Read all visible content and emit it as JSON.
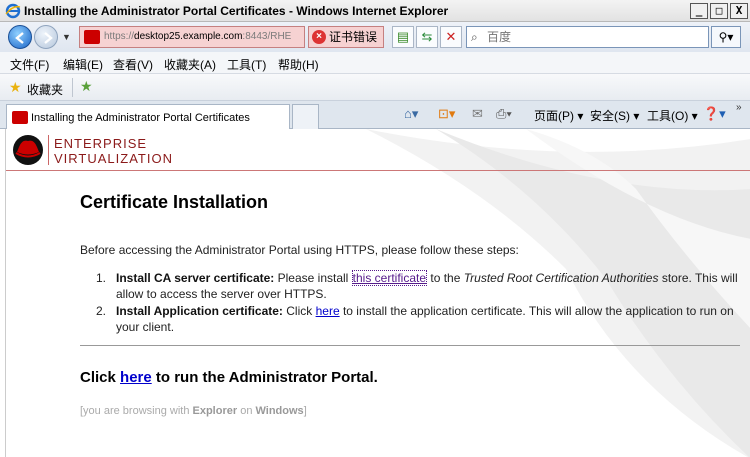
{
  "window": {
    "title": "Installing the Administrator Portal Certificates - Windows Internet Explorer",
    "min_label": "_",
    "max_label": "□",
    "close_label": "X"
  },
  "address": {
    "url_prefix": "https://",
    "url_host": "desktop25.example.com",
    "url_rest": ":8443/RHE",
    "cert_error": "证书错误",
    "search_placeholder": "百度"
  },
  "menu": [
    "文件(F)",
    "编辑(E)",
    "查看(V)",
    "收藏夹(A)",
    "工具(T)",
    "帮助(H)"
  ],
  "favorites": {
    "label": "收藏夹"
  },
  "tab": {
    "title": "Installing the Administrator Portal Certificates"
  },
  "commandbar": {
    "page": "页面(P)",
    "safety": "安全(S)",
    "tools": "工具(O)"
  },
  "brand": {
    "line1": "ENTERPRISE",
    "line2": "VIRTUALIZATION"
  },
  "content": {
    "heading": "Certificate Installation",
    "intro": "Before accessing the Administrator Portal using HTTPS, please follow these steps:",
    "steps": [
      {
        "num": "1.",
        "title": "Install CA server certificate:",
        "pre": " Please install ",
        "link": "this certificate",
        "mid": " to the ",
        "em": "Trusted Root Certification Authorities",
        "post": " store. This will allow to access the server over HTTPS."
      },
      {
        "num": "2.",
        "title": "Install Application certificate:",
        "pre": " Click ",
        "link": "here",
        "post": " to install the application certificate. This will allow the application to run on your client."
      }
    ],
    "run_pre": "Click ",
    "run_link": "here",
    "run_post": " to run the Administrator Portal.",
    "browsing_pre": "[you are browsing with ",
    "browsing_browser": "Explorer",
    "browsing_mid": " on ",
    "browsing_os": "Windows",
    "browsing_post": "]"
  },
  "colors": {
    "brand_red": "#8b1a1a",
    "link": "#0000cc",
    "visited": "#551a8b",
    "cert_error_bg": "#f6d2d2"
  }
}
